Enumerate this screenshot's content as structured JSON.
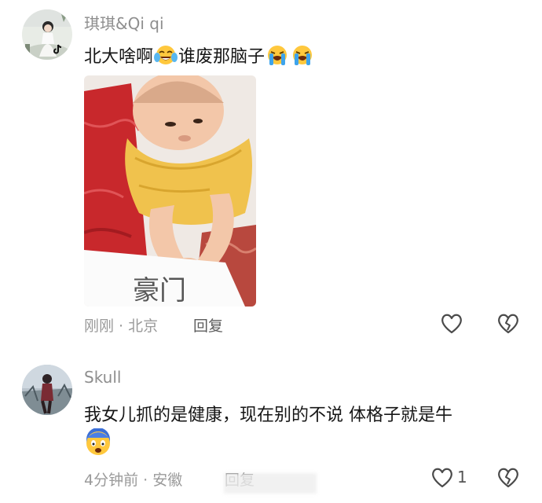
{
  "comments": [
    {
      "username": "琪琪&Qi qi",
      "text_before": "北大啥啊",
      "text_after": "谁废那脑子",
      "meta": "刚刚 · 北京",
      "reply_label": "回复",
      "image_caption": "豪门"
    },
    {
      "username": "Skull",
      "text": "我女儿抓的是健康，现在别的不说 体格子就是牛",
      "meta": "4分钟前 · 安徽",
      "reply_label": "回复",
      "like_count": "1"
    }
  ],
  "icons": {
    "like": "heart-outline-icon",
    "dislike": "broken-heart-icon",
    "emoji_laugh": "tears-of-joy-emoji",
    "emoji_cry": "loudly-crying-emoji",
    "emoji_shocked": "shocked-emoji"
  },
  "colors": {
    "username": "#8e8e8e",
    "text": "#161616",
    "meta": "#9a9a9a",
    "icon_stroke": "#4a4a4a",
    "emoji_yellow": "#ffc83d"
  }
}
